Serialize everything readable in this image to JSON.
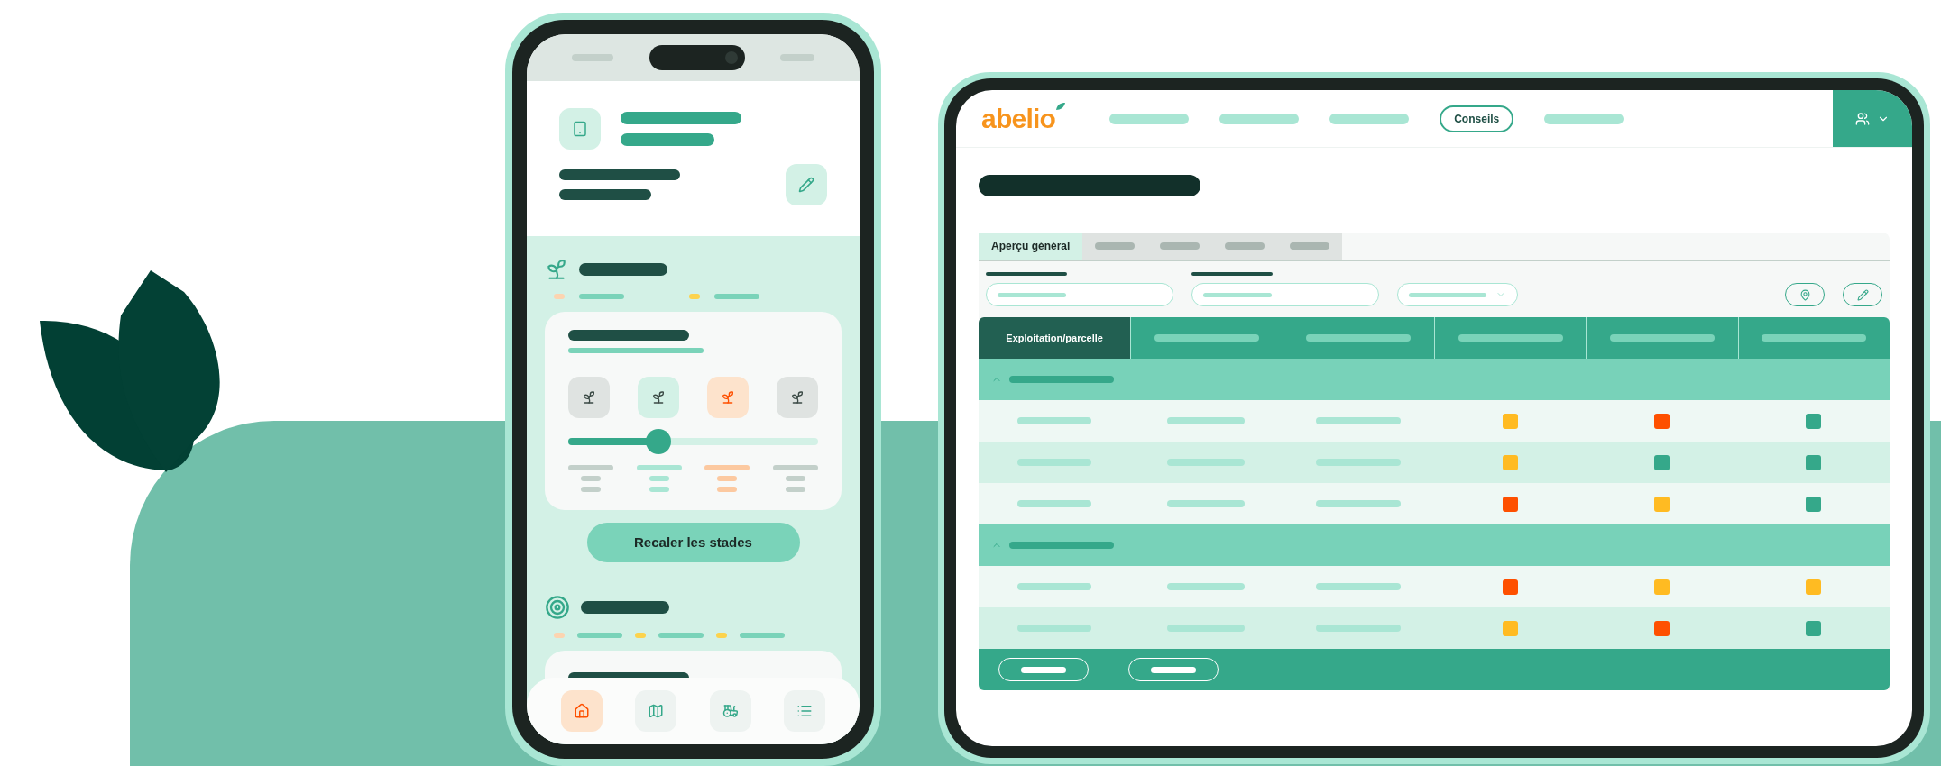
{
  "phone": {
    "stages": [
      {
        "color": "#dfe3e1",
        "selected": false
      },
      {
        "color": "#d3f1e6",
        "selected": false
      },
      {
        "color": "#fde3cc",
        "selected": true
      },
      {
        "color": "#dfe3e1",
        "selected": false
      }
    ],
    "slider": {
      "level": 0.36
    },
    "recalibrate_button": "Recaler les stades",
    "bottom_nav": [
      {
        "kind": "home",
        "selected": true
      },
      {
        "kind": "map",
        "selected": false
      },
      {
        "kind": "tractor",
        "selected": false
      },
      {
        "kind": "list",
        "selected": false
      }
    ]
  },
  "tablet": {
    "logo": "abelio",
    "nav": [
      {
        "selected": false
      },
      {
        "selected": false
      },
      {
        "selected": false
      },
      {
        "label": "Conseils",
        "selected": true
      },
      {
        "selected": false
      }
    ],
    "tabs": [
      {
        "label": "Aperçu général",
        "selected": true
      },
      {
        "selected": false
      },
      {
        "selected": false
      },
      {
        "selected": false
      },
      {
        "selected": false
      }
    ],
    "table": {
      "first_column": "Exploitation/parcelle",
      "groups": [
        {
          "expanded": true,
          "rows": [
            {
              "statuses": [
                {
                  "color": "#ffbb22"
                },
                {
                  "color": "#fe5000"
                },
                {
                  "color": "#35a88a"
                }
              ]
            },
            {
              "statuses": [
                {
                  "color": "#ffbb22"
                },
                {
                  "color": "#35a88a"
                },
                {
                  "color": "#35a88a"
                }
              ]
            },
            {
              "statuses": [
                {
                  "color": "#fe5000"
                },
                {
                  "color": "#ffbb22"
                },
                {
                  "color": "#35a88a"
                }
              ]
            }
          ]
        },
        {
          "expanded": true,
          "rows": [
            {
              "statuses": [
                {
                  "color": "#fe5000"
                },
                {
                  "color": "#ffbb22"
                },
                {
                  "color": "#ffbb22"
                }
              ]
            },
            {
              "statuses": [
                {
                  "color": "#ffbb22"
                },
                {
                  "color": "#fe5000"
                },
                {
                  "color": "#35a88a"
                }
              ]
            }
          ]
        }
      ]
    }
  }
}
